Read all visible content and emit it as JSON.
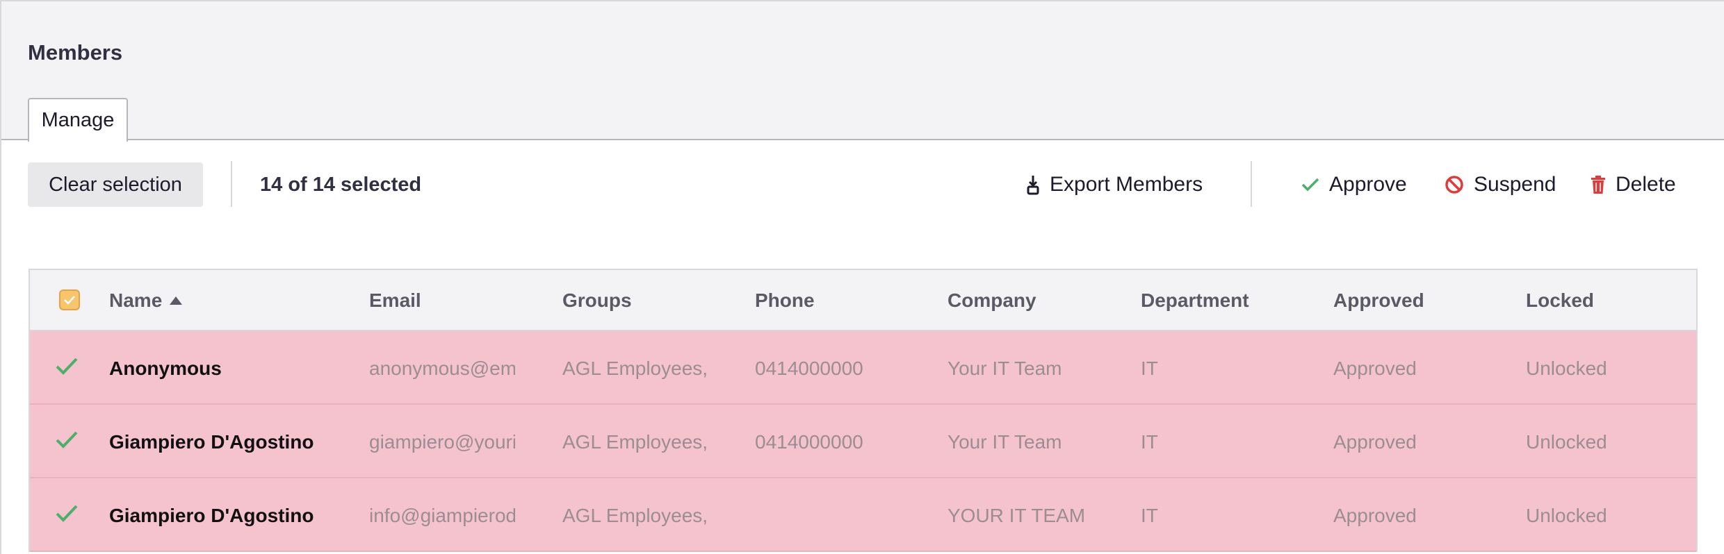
{
  "header": {
    "title": "Members",
    "tabs": [
      {
        "label": "Manage",
        "active": true
      }
    ]
  },
  "toolbar": {
    "clear_label": "Clear selection",
    "selected_text": "14 of 14 selected",
    "export_label": "Export Members",
    "approve_label": "Approve",
    "suspend_label": "Suspend",
    "delete_label": "Delete"
  },
  "table": {
    "columns": [
      "Name",
      "Email",
      "Groups",
      "Phone",
      "Company",
      "Department",
      "Approved",
      "Locked"
    ],
    "sort": {
      "column": "Name",
      "direction": "ascending"
    },
    "rows": [
      {
        "name": "Anonymous",
        "email": "anonymous@ema",
        "groups": "AGL Employees, N",
        "phone": "0414000000",
        "company": "Your IT Team",
        "department": "IT",
        "approved": "Approved",
        "locked": "Unlocked"
      },
      {
        "name": "Giampiero D'Agostino",
        "email": "giampiero@yourit",
        "groups": "AGL Employees, N",
        "phone": "0414000000",
        "company": "Your IT Team",
        "department": "IT",
        "approved": "Approved",
        "locked": "Unlocked"
      },
      {
        "name": "Giampiero D'Agostino",
        "email": "info@giampieroda",
        "groups": "AGL Employees, N",
        "phone": "",
        "company": "YOUR IT TEAM",
        "department": "IT",
        "approved": "Approved",
        "locked": "Unlocked"
      }
    ]
  },
  "colors": {
    "selected_row": "#f5c3cd",
    "check_green": "#4caf6a",
    "danger_red": "#e03b3b",
    "header_bg": "#f3f3f5"
  }
}
